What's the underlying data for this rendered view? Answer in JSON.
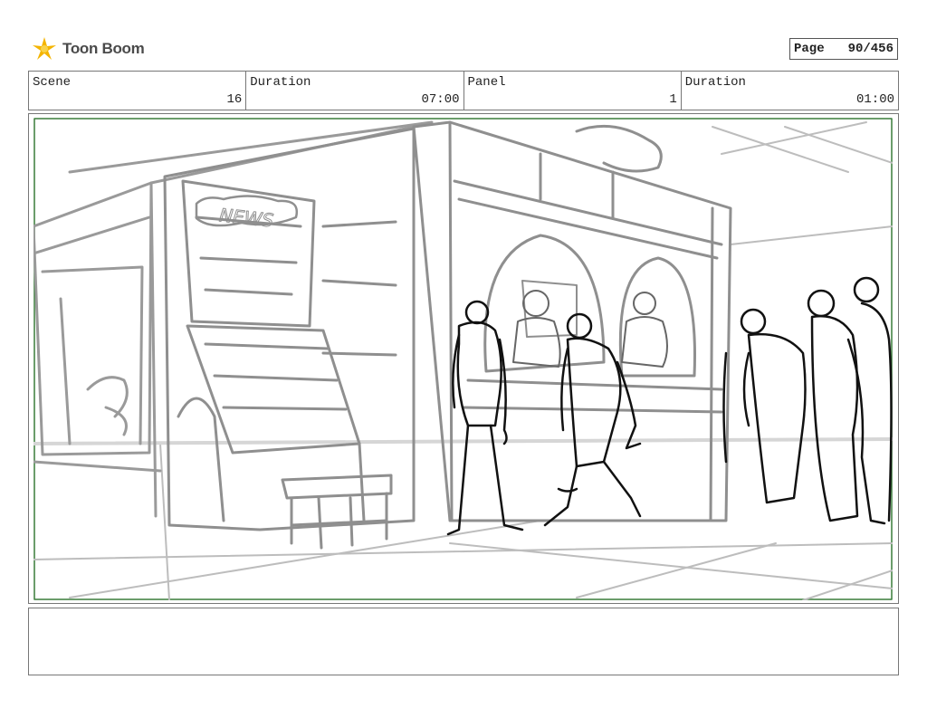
{
  "header": {
    "logo_text": "Toon Boom",
    "page_label": "Page",
    "page_value": "90/456"
  },
  "info": {
    "scene_label": "Scene",
    "scene_value": "16",
    "scene_duration_label": "Duration",
    "scene_duration_value": "07:00",
    "panel_label": "Panel",
    "panel_value": "1",
    "panel_duration_label": "Duration",
    "panel_duration_value": "01:00"
  },
  "panel": {
    "sign_text": "NEWS",
    "frame_color": "#3a7d3a"
  },
  "notes": {
    "text": ""
  }
}
